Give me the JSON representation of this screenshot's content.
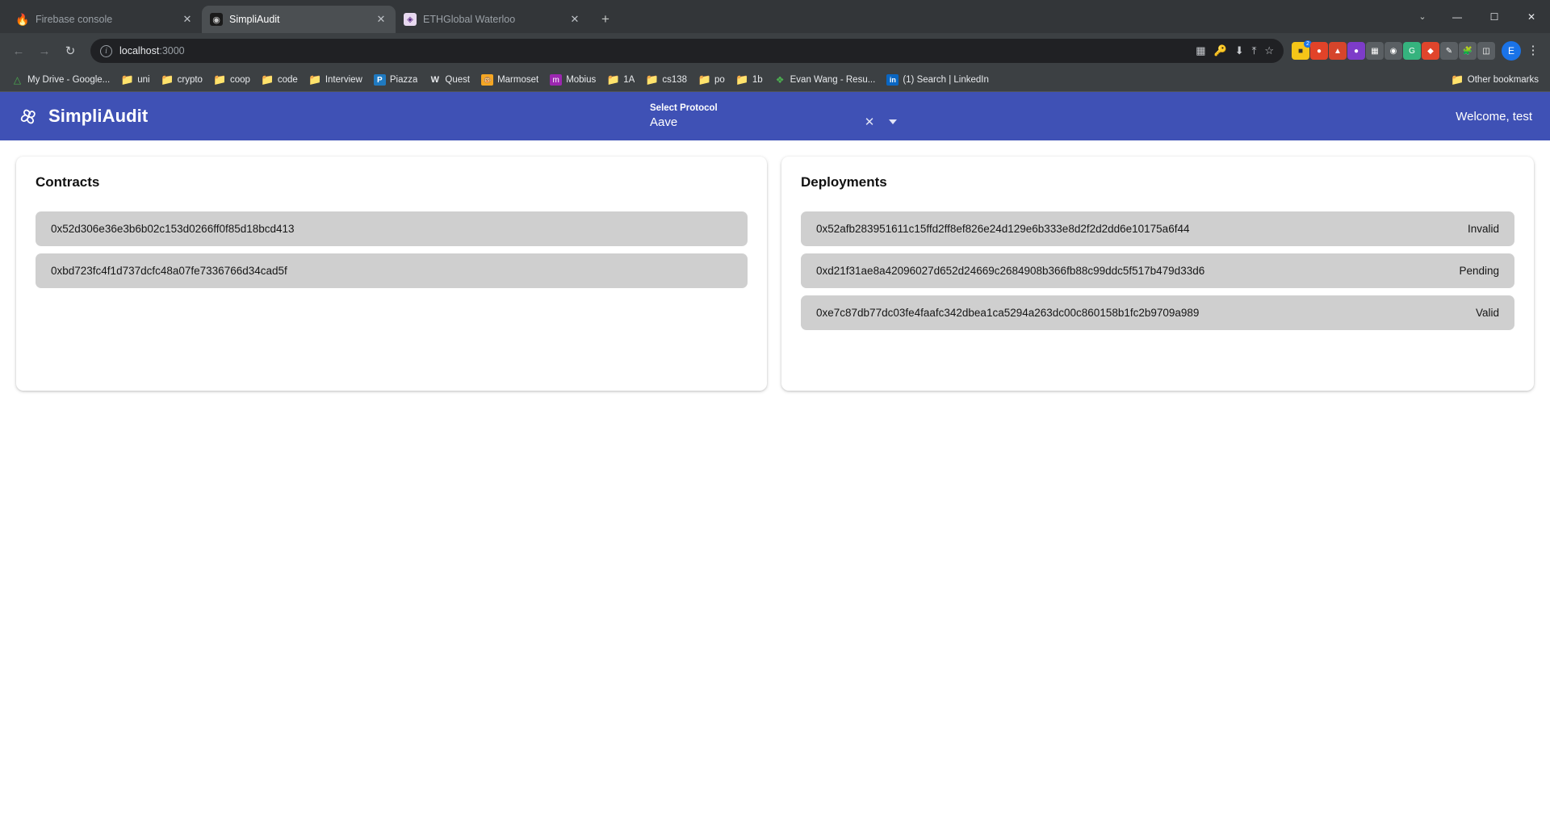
{
  "browser": {
    "tabs": [
      {
        "title": "Firebase console",
        "favicon": "firebase-icon",
        "active": false
      },
      {
        "title": "SimpliAudit",
        "favicon": "simpliaudit-icon",
        "active": true
      },
      {
        "title": "ETHGlobal Waterloo",
        "favicon": "ethglobal-icon",
        "active": false
      }
    ],
    "new_tab_label": "+",
    "window_controls": {
      "chevron": "⌄",
      "minimize": "—",
      "maximize": "☐",
      "close": "✕"
    },
    "toolbar": {
      "back": "←",
      "forward": "→",
      "reload": "↻",
      "url_host": "localhost",
      "url_port": ":3000",
      "info_icon": "i",
      "bookmark_star": "☆",
      "share_icon": "⤒",
      "install_icon": "⬇",
      "cast_icon": "▣",
      "profile_initial": "E",
      "menu": "⋮"
    },
    "bookmarks": [
      {
        "label": "My Drive - Google...",
        "icon": "drive-icon"
      },
      {
        "label": "uni",
        "icon": "folder-icon"
      },
      {
        "label": "crypto",
        "icon": "folder-icon"
      },
      {
        "label": "coop",
        "icon": "folder-icon"
      },
      {
        "label": "code",
        "icon": "folder-icon"
      },
      {
        "label": "Interview",
        "icon": "folder-icon"
      },
      {
        "label": "Piazza",
        "icon": "piazza-icon"
      },
      {
        "label": "Quest",
        "icon": "quest-icon"
      },
      {
        "label": "Marmoset",
        "icon": "marmoset-icon"
      },
      {
        "label": "Mobius",
        "icon": "mobius-icon"
      },
      {
        "label": "1A",
        "icon": "folder-icon"
      },
      {
        "label": "cs138",
        "icon": "folder-icon"
      },
      {
        "label": "po",
        "icon": "folder-icon"
      },
      {
        "label": "1b",
        "icon": "folder-icon"
      },
      {
        "label": "Evan Wang - Resu...",
        "icon": "leaf-icon"
      },
      {
        "label": "(1) Search | LinkedIn",
        "icon": "linkedin-icon"
      }
    ],
    "other_bookmarks": {
      "label": "Other bookmarks",
      "icon": "folder-icon"
    }
  },
  "app": {
    "brand": "SimpliAudit",
    "brand_icon": "spiral-logo-icon",
    "header_color": "#3f51b5",
    "protocol_selector": {
      "label": "Select Protocol",
      "value": "Aave",
      "clear_icon": "✕",
      "caret_icon": "chevron-down-icon"
    },
    "welcome": "Welcome, test",
    "contracts_card": {
      "title": "Contracts",
      "rows": [
        {
          "address": "0x52d306e36e3b6b02c153d0266ff0f85d18bcd413"
        },
        {
          "address": "0xbd723fc4f1d737dcfc48a07fe7336766d34cad5f"
        }
      ]
    },
    "deployments_card": {
      "title": "Deployments",
      "rows": [
        {
          "address": "0x52afb283951611c15ffd2ff8ef826e24d129e6b333e8d2f2d2dd6e10175a6f44",
          "status": "Invalid"
        },
        {
          "address": "0xd21f31ae8a42096027d652d24669c2684908b366fb88c99ddc5f517b479d33d6",
          "status": "Pending"
        },
        {
          "address": "0xe7c87db77dc03fe4faafc342dbea1ca5294a263dc00c860158b1fc2b9709a989",
          "status": "Valid"
        }
      ]
    }
  }
}
